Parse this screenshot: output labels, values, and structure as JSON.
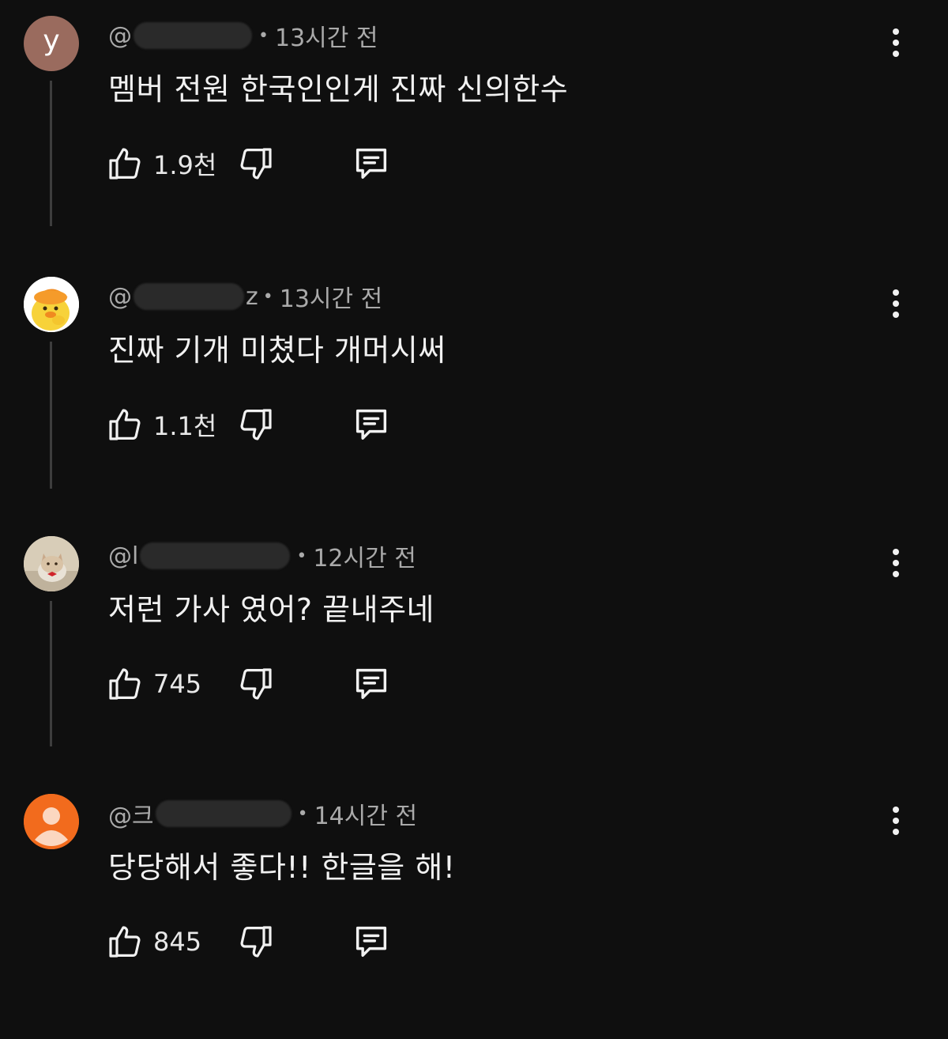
{
  "comments": [
    {
      "avatar_letter": "y",
      "handle_prefix": "@",
      "handle_suffix": "",
      "time": "13시간 전",
      "text": "멤버 전원 한국인인게 진짜 신의한수",
      "likes": "1.9천"
    },
    {
      "avatar_letter": "",
      "handle_prefix": "@",
      "handle_suffix": "z",
      "time": "13시간 전",
      "text": "진짜 기개 미쳤다 개머시써",
      "likes": "1.1천"
    },
    {
      "avatar_letter": "",
      "handle_prefix": "@l",
      "handle_suffix": "",
      "time": "12시간 전",
      "text": "저런 가사 였어? 끝내주네",
      "likes": "745"
    },
    {
      "avatar_letter": "",
      "handle_prefix": "@크",
      "handle_suffix": "",
      "time": "14시간 전",
      "text": "당당해서 좋다!! 한글을 해!",
      "likes": "845"
    }
  ],
  "icons": {
    "like": "thumbs-up-icon",
    "dislike": "thumbs-down-icon",
    "reply": "comment-icon",
    "more": "more-vertical-icon"
  },
  "colors": {
    "background": "#0f0f0f",
    "text": "#f1f1f1",
    "secondary_text": "#aaaaaa",
    "default_avatar": "#f26b1d"
  }
}
